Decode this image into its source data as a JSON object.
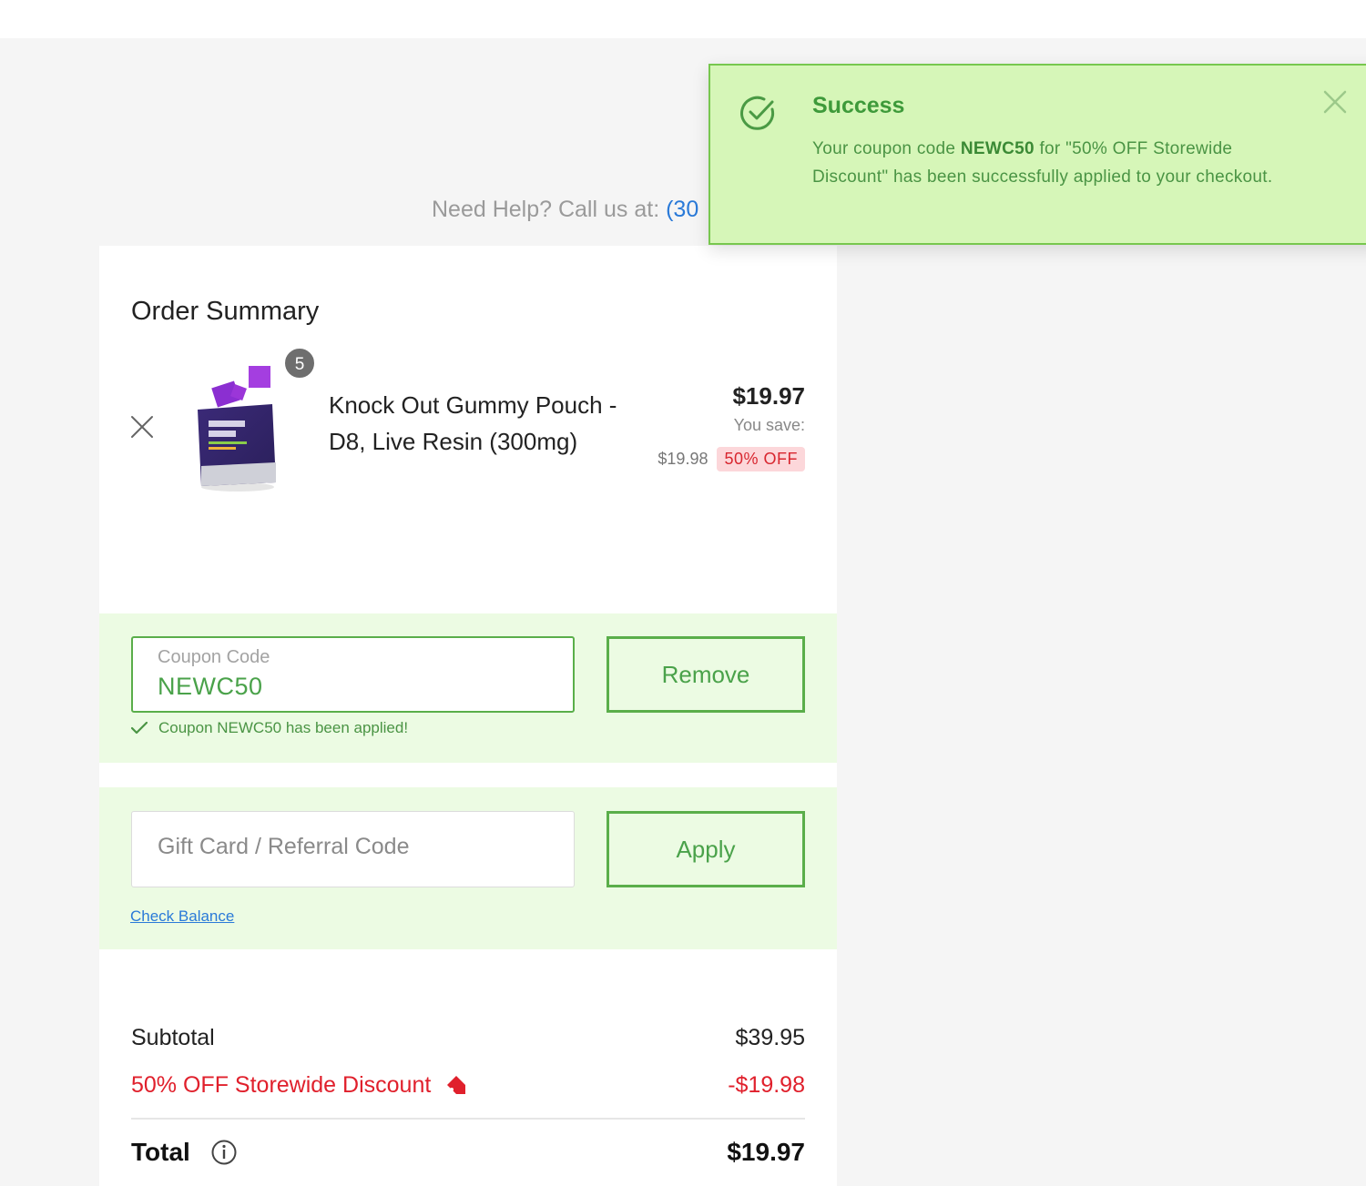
{
  "help": {
    "text": "Need Help? Call us at: ",
    "phone": "(30"
  },
  "toast": {
    "title": "Success",
    "message_pre": "Your coupon code ",
    "code": "NEWC50",
    "message_post": " for \"50% OFF Storewide Discount\" has been successfully applied to your checkout.",
    "color": "#d6f6b8"
  },
  "order": {
    "title": "Order Summary",
    "item": {
      "quantity": "5",
      "name": "Knock Out Gummy Pouch - D8, Live Resin (300mg)",
      "price": "$19.97",
      "you_save_label": "You save:",
      "save_amount": "$19.98",
      "discount_badge": "50% OFF"
    }
  },
  "coupon": {
    "label": "Coupon Code",
    "value": "NEWC50",
    "button": "Remove",
    "status": "Coupon NEWC50 has been applied!"
  },
  "gift": {
    "placeholder": "Gift Card / Referral Code",
    "button": "Apply",
    "check_balance": "Check Balance"
  },
  "totals": {
    "subtotal_label": "Subtotal",
    "subtotal_value": "$39.95",
    "discount_label": "50% OFF Storewide Discount",
    "discount_value": "-$19.98",
    "total_label": "Total",
    "total_value": "$19.97"
  },
  "colors": {
    "accent": "#5aae4a",
    "discount": "#e0202c",
    "link": "#2a7ad8"
  }
}
